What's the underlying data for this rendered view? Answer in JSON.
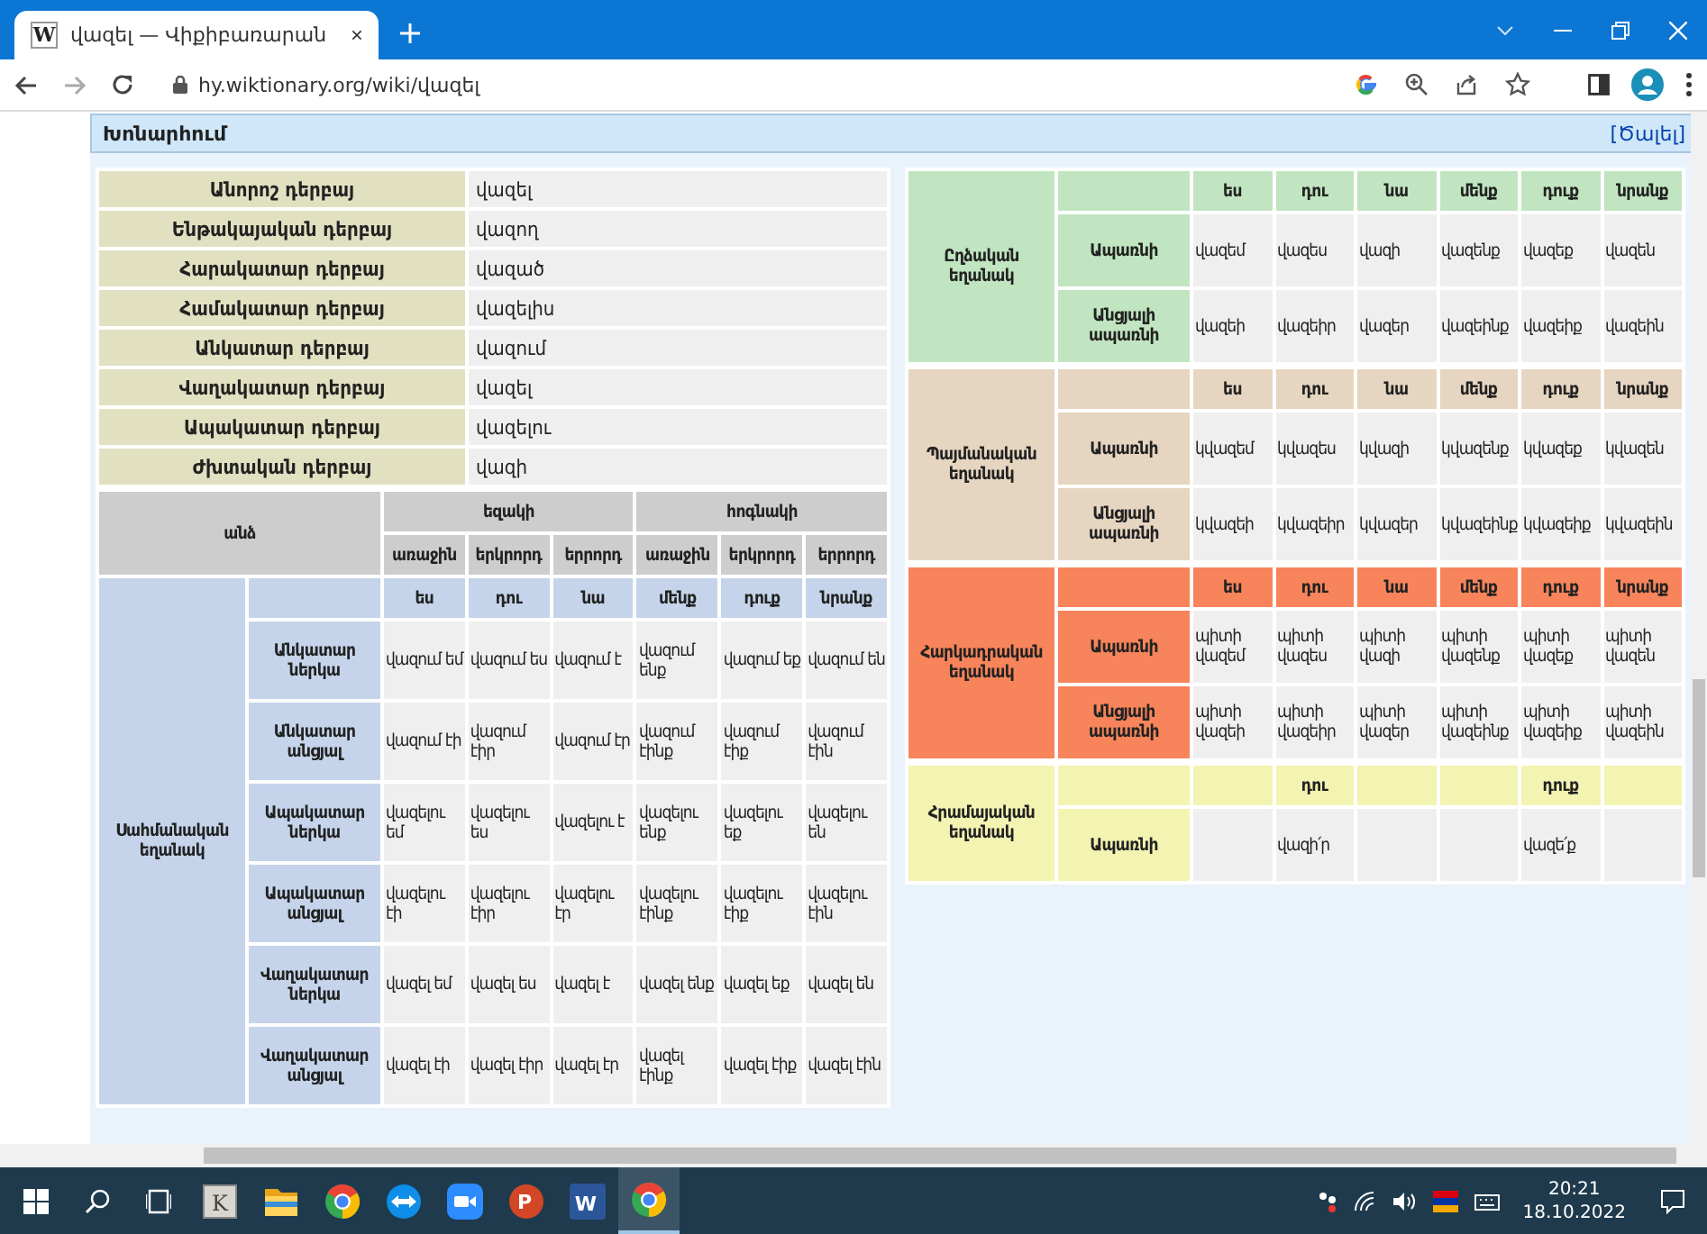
{
  "browser": {
    "tab_title": "վազել — Վիքիբառարան",
    "favicon": "W",
    "url": "hy.wiktionary.org/wiki/վազել"
  },
  "section": {
    "title": "Խոնարհում",
    "toggle": "[Ծալել]"
  },
  "participles": [
    {
      "label": "Անորոշ դերբայ",
      "value": "վազել"
    },
    {
      "label": "Ենթակայական դերբայ",
      "value": "վազող"
    },
    {
      "label": "Հարակատար դերբայ",
      "value": "վազած"
    },
    {
      "label": "Համակատար դերբայ",
      "value": "վազելիս"
    },
    {
      "label": "Անկատար դերբայ",
      "value": "վազում"
    },
    {
      "label": "Վաղակատար դերբայ",
      "value": "վազել"
    },
    {
      "label": "Ապակատար դերբայ",
      "value": "վազելու"
    },
    {
      "label": "Ժխտական դերբայ",
      "value": "վազի"
    }
  ],
  "indicative": {
    "person_header": "անձ",
    "numbers": [
      "եզակի",
      "հոգնակի"
    ],
    "persons": [
      "առաջին",
      "երկրորդ",
      "երրորդ",
      "առաջին",
      "երկրորդ",
      "երրորդ"
    ],
    "mood": "Սահմանական եղանակ",
    "color": "#c5d4ea",
    "pronouns": [
      "ես",
      "դու",
      "նա",
      "մենք",
      "դուք",
      "նրանք"
    ],
    "rows": [
      {
        "tense": "Անկատար ներկա",
        "forms": [
          "վազում եմ",
          "վազում ես",
          "վազում է",
          "վազում ենք",
          "վազում եք",
          "վազում են"
        ]
      },
      {
        "tense": "Անկատար անցյալ",
        "forms": [
          "վազում էի",
          "վազում էիր",
          "վազում էր",
          "վազում էինք",
          "վազում էիք",
          "վազում էին"
        ]
      },
      {
        "tense": "Ապակատար ներկա",
        "forms": [
          "վազելու եմ",
          "վազելու ես",
          "վազելու է",
          "վազելու ենք",
          "վազելու եք",
          "վազելու են"
        ]
      },
      {
        "tense": "Ապակատար անցյալ",
        "forms": [
          "վազելու էի",
          "վազելու էիր",
          "վազելու էր",
          "վազելու էինք",
          "վազելու էիք",
          "վազելու էին"
        ]
      },
      {
        "tense": "Վաղակատար ներկա",
        "forms": [
          "վազել եմ",
          "վազել ես",
          "վազել է",
          "վազել ենք",
          "վազել եք",
          "վազել են"
        ]
      },
      {
        "tense": "Վաղակատար անցյալ",
        "forms": [
          "վազել էի",
          "վազել էիր",
          "վազել էր",
          "վազել էինք",
          "վազել էիք",
          "վազել էին"
        ]
      }
    ]
  },
  "moods": [
    {
      "mood": "Ըղձական եղանակ",
      "color": "#c0e5c0",
      "pronouns": [
        "ես",
        "դու",
        "նա",
        "մենք",
        "դուք",
        "նրանք"
      ],
      "rows": [
        {
          "tense": "Ապառնի",
          "forms": [
            "վազեմ",
            "վազես",
            "վազի",
            "վազենք",
            "վազեք",
            "վազեն"
          ]
        },
        {
          "tense": "Անցյալի ապառնի",
          "forms": [
            "վազեի",
            "վազեիր",
            "վազեր",
            "վազեինք",
            "վազեիք",
            "վազեին"
          ]
        }
      ]
    },
    {
      "mood": "Պայմանական եղանակ",
      "color": "#e6d5c0",
      "pronouns": [
        "ես",
        "դու",
        "նա",
        "մենք",
        "դուք",
        "նրանք"
      ],
      "rows": [
        {
          "tense": "Ապառնի",
          "forms": [
            "կվազեմ",
            "կվազես",
            "կվազի",
            "կվազենք",
            "կվազեք",
            "կվազեն"
          ]
        },
        {
          "tense": "Անցյալի ապառնի",
          "forms": [
            "կվազեի",
            "կվազեիր",
            "կվազեր",
            "կվազեինք",
            "կվազեիք",
            "կվազեին"
          ]
        }
      ]
    },
    {
      "mood": "Հարկադրական եղանակ",
      "color": "#f7845a",
      "pronouns": [
        "ես",
        "դու",
        "նա",
        "մենք",
        "դուք",
        "նրանք"
      ],
      "rows": [
        {
          "tense": "Ապառնի",
          "forms": [
            "պիտի վազեմ",
            "պիտի վազես",
            "պիտի վազի",
            "պիտի վազենք",
            "պիտի վազեք",
            "պիտի վազեն"
          ]
        },
        {
          "tense": "Անցյալի ապառնի",
          "forms": [
            "պիտի վազեի",
            "պիտի վազեիր",
            "պիտի վազեր",
            "պիտի վազեինք",
            "պիտի վազեիք",
            "պիտի վազեին"
          ]
        }
      ]
    },
    {
      "mood": "Հրամայական եղանակ",
      "color": "#f3f3b2",
      "pronouns": [
        {
          "kind": "blank"
        },
        {
          "kind": "word",
          "text": "դու"
        },
        {
          "kind": "blank"
        },
        {
          "kind": "blank"
        },
        {
          "kind": "word",
          "text": "դուք"
        },
        {
          "kind": "blank"
        }
      ],
      "rows": [
        {
          "tense": "Ապառնի",
          "forms": [
            {
              "kind": "blank"
            },
            {
              "kind": "word",
              "text": "վազի՛ր"
            },
            {
              "kind": "blank"
            },
            {
              "kind": "blank"
            },
            {
              "kind": "word",
              "text": "վազե՛ք"
            },
            {
              "kind": "blank"
            }
          ]
        }
      ]
    }
  ],
  "taskbar": {
    "items": [
      {
        "kind": "start",
        "selected": false
      },
      {
        "kind": "search",
        "selected": false
      },
      {
        "kind": "taskview",
        "selected": false
      },
      {
        "kind": "letter-app",
        "letter": "K",
        "selected": false
      },
      {
        "kind": "folder",
        "selected": false
      },
      {
        "kind": "chrome",
        "selected": false
      },
      {
        "kind": "remote",
        "selected": false
      },
      {
        "kind": "camera",
        "selected": false
      },
      {
        "kind": "slides",
        "letter": "P",
        "selected": false
      },
      {
        "kind": "word",
        "letter": "W",
        "selected": false
      },
      {
        "kind": "chrome",
        "selected": true
      }
    ],
    "time": "20:21",
    "date": "18.10.2022"
  }
}
